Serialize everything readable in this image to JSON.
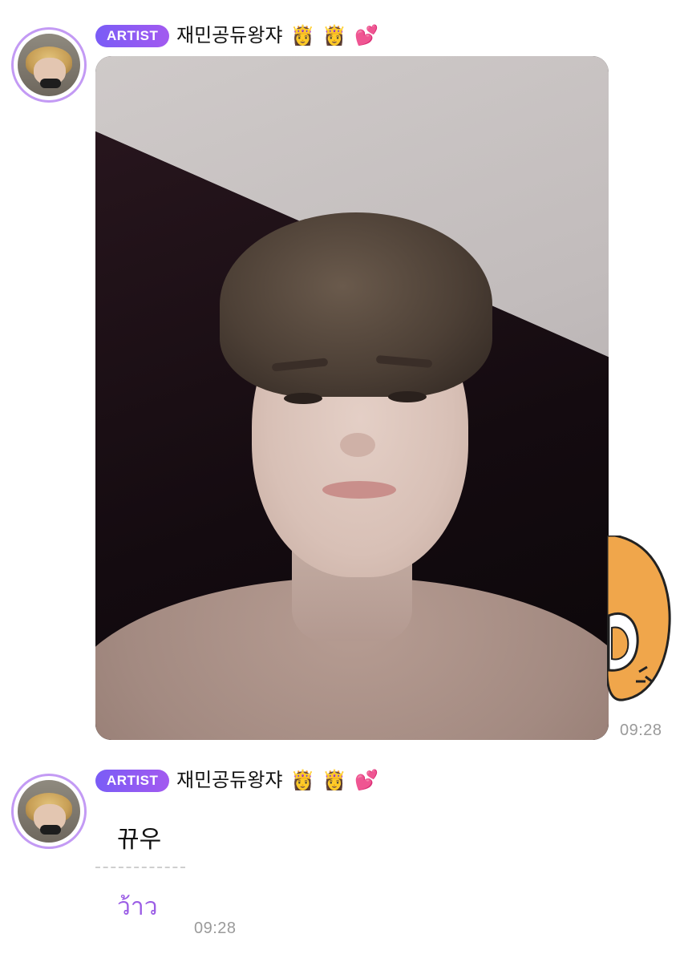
{
  "messages": [
    {
      "badge": "ARTIST",
      "sender": "재민공듀왕쟈",
      "emojis": [
        "👸",
        "👸",
        "💕"
      ],
      "time": "09:28"
    },
    {
      "badge": "ARTIST",
      "sender": "재민공듀왕쟈",
      "emojis": [
        "👸",
        "👸",
        "💕"
      ],
      "text": "뀨우",
      "translation": "ว้าว",
      "time": "09:28"
    }
  ],
  "colors": {
    "badge_start": "#7a5cf6",
    "badge_end": "#a25af0",
    "avatar_ring": "#c39af4",
    "translation_text": "#9b5de5",
    "timestamp": "#9a9a9a"
  }
}
